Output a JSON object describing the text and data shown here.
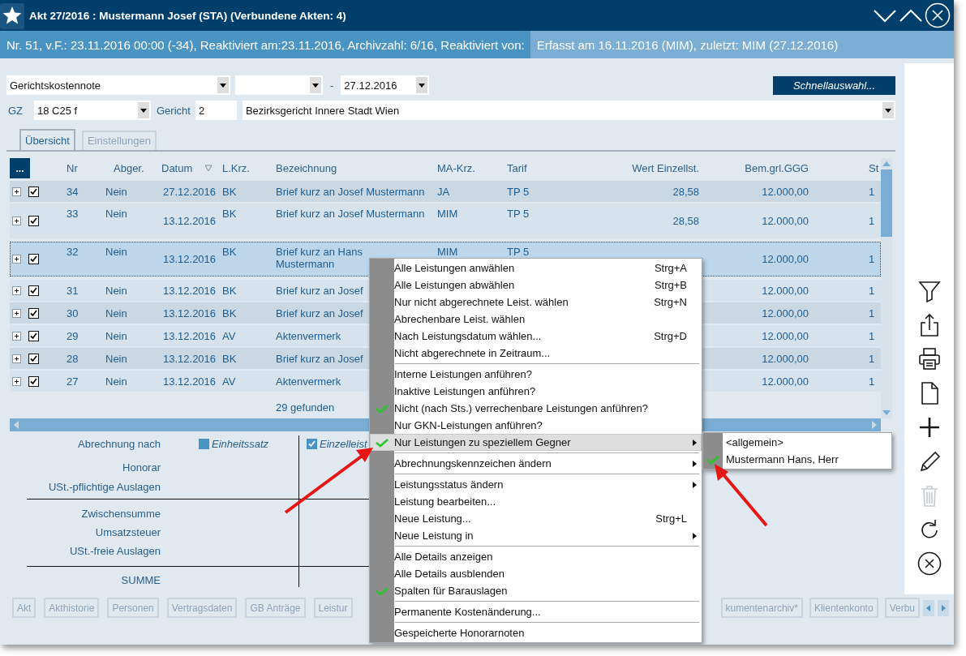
{
  "window": {
    "title": "Akt 27/2016 : Mustermann Josef (STA) (Verbundene Akten: 4)"
  },
  "info_bar": {
    "left": "Nr. 51, v.F.: 23.11.2016 00:00 (-34), Reaktiviert am:23.11.2016, Archivzahl: 6/16, Reaktiviert von:",
    "right": "Erfasst am 16.11.2016 (MIM), zuletzt: MIM (27.12.2016)"
  },
  "filter_row": {
    "document_type": "Gerichtskostennote",
    "date_separator": "-",
    "date_to": "27.12.2016",
    "quick_button": "Schnellauswahl..."
  },
  "court_row": {
    "gz_label": "GZ",
    "gz_value": "18 C25 f",
    "court_label": "Gericht",
    "court_number": "2",
    "court_name": "Bezirksgericht Innere Stadt Wien"
  },
  "tabs": [
    {
      "label": "Übersicht",
      "selected": true
    },
    {
      "label": "Einstellungen",
      "selected": false
    }
  ],
  "table": {
    "menu_button": "...",
    "columns": [
      {
        "label": "Nr",
        "sorted": false
      },
      {
        "label": "Abger.",
        "sorted": false
      },
      {
        "label": "Datum",
        "sorted": true
      },
      {
        "label": "L.Krz.",
        "sorted": false
      },
      {
        "label": "Bezeichnung",
        "sorted": false
      },
      {
        "label": "MA-Krz.",
        "sorted": false
      },
      {
        "label": "Tarif",
        "sorted": false
      },
      {
        "label": "Wert Einzellst.",
        "sorted": false
      },
      {
        "label": "Bem.grl.GGG",
        "sorted": false
      },
      {
        "label": "St",
        "sorted": false
      }
    ],
    "rows": [
      {
        "kind": "short",
        "expanded": false,
        "checked": true,
        "selected": false,
        "nr": "34",
        "abger": "Nein",
        "datum": "27.12.2016",
        "lkrz": "BK",
        "bezeichnung": "Brief kurz an Josef Mustermann",
        "ma_krz": "JA",
        "tarif": "TP 5",
        "wert": "28,58",
        "bem": "12.000,00",
        "st": "1"
      },
      {
        "kind": "tall",
        "expanded": false,
        "checked": true,
        "selected": false,
        "nr": "33",
        "abger": "Nein",
        "datum": "13.12.2016",
        "lkrz": "BK",
        "bezeichnung": "Brief kurz an Josef Mustermann",
        "ma_krz": "MIM",
        "tarif": "TP 5",
        "wert": "28,58",
        "bem": "12.000,00",
        "st": "1"
      },
      {
        "kind": "tall",
        "expanded": false,
        "checked": true,
        "selected": true,
        "nr": "32",
        "abger": "Nein",
        "datum": "13.12.2016",
        "lkrz": "BK",
        "bezeichnung": "Brief kurz an Hans\nMustermann",
        "ma_krz": "MIM",
        "tarif": "TP 5",
        "bem": "12.000,00",
        "st": "1"
      },
      {
        "kind": "short",
        "expanded": false,
        "checked": true,
        "selected": false,
        "nr": "31",
        "abger": "Nein",
        "datum": "13.12.2016",
        "lkrz": "BK",
        "bezeichnung": "Brief kurz an Josef",
        "bem": "12.000,00",
        "st": "1"
      },
      {
        "kind": "short",
        "expanded": false,
        "checked": true,
        "selected": false,
        "nr": "30",
        "abger": "Nein",
        "datum": "13.12.2016",
        "lkrz": "BK",
        "bezeichnung": "Brief kurz an Josef",
        "bem": "12.000,00",
        "st": "1"
      },
      {
        "kind": "short",
        "expanded": false,
        "checked": true,
        "selected": false,
        "nr": "29",
        "abger": "Nein",
        "datum": "13.12.2016",
        "lkrz": "AV",
        "bezeichnung": "Aktenvermerk",
        "bem": "12.000,00",
        "st": "1"
      },
      {
        "kind": "short",
        "expanded": false,
        "checked": true,
        "selected": false,
        "nr": "28",
        "abger": "Nein",
        "datum": "13.12.2016",
        "lkrz": "BK",
        "bezeichnung": "Brief kurz an Josef",
        "bem": "12.000,00",
        "st": "1"
      },
      {
        "kind": "short",
        "expanded": false,
        "checked": true,
        "selected": false,
        "nr": "27",
        "abger": "Nein",
        "datum": "13.12.2016",
        "lkrz": "AV",
        "bezeichnung": "Aktenvermerk",
        "bem": "12.000,00",
        "st": "1"
      }
    ],
    "footer": "29 gefunden"
  },
  "summary": {
    "basis_label": "Abrechnung nach",
    "options": [
      {
        "label": "Einheitssatz",
        "checked": false
      },
      {
        "label": "Einzelleist",
        "checked": true
      }
    ],
    "groups": [
      [
        "Honorar",
        "USt.-pflichtige Auslagen"
      ],
      [
        "Zwischensumme",
        "Umsatzsteuer",
        "USt.-freie Auslagen"
      ],
      [
        "SUMME"
      ]
    ]
  },
  "bottom_tabs": {
    "left": [
      "Akt",
      "Akthistorie",
      "Personen",
      "Vertragsdaten",
      "GB Anträge",
      "Leistur"
    ],
    "right": [
      "kumentenarchiv*",
      "Klientenkonto",
      "Verbu"
    ]
  },
  "sidebar_tools": [
    {
      "kind": "filter",
      "disabled": false
    },
    {
      "kind": "export",
      "disabled": false
    },
    {
      "kind": "print",
      "disabled": false
    },
    {
      "kind": "document",
      "disabled": false
    },
    {
      "kind": "add",
      "disabled": false
    },
    {
      "kind": "edit",
      "disabled": false
    },
    {
      "kind": "delete",
      "disabled": true
    },
    {
      "kind": "refresh",
      "disabled": false
    },
    {
      "kind": "cancel",
      "disabled": false
    }
  ],
  "context_menu": {
    "items": [
      {
        "kind": "item",
        "label": "Alle Leistungen anwählen",
        "shortcut": "Strg+A",
        "checked": false,
        "submenu": false,
        "selected": false
      },
      {
        "kind": "item",
        "label": "Alle Leistungen abwählen",
        "shortcut": "Strg+B",
        "checked": false,
        "submenu": false,
        "selected": false
      },
      {
        "kind": "item",
        "label": "Nur nicht abgerechnete Leist. wählen",
        "shortcut": "Strg+N",
        "checked": false,
        "submenu": false,
        "selected": false
      },
      {
        "kind": "item",
        "label": "Abrechenbare Leist. wählen",
        "checked": false,
        "submenu": false,
        "selected": false
      },
      {
        "kind": "item",
        "label": "Nach Leistungsdatum wählen...",
        "shortcut": "Strg+D",
        "checked": false,
        "submenu": false,
        "selected": false
      },
      {
        "kind": "item",
        "label": "Nicht abgerechnete in Zeitraum...",
        "checked": false,
        "submenu": false,
        "selected": false
      },
      {
        "kind": "separator"
      },
      {
        "kind": "item",
        "label": "Interne Leistungen anführen?",
        "checked": false,
        "submenu": false,
        "selected": false
      },
      {
        "kind": "item",
        "label": "Inaktive Leistungen anführen?",
        "checked": false,
        "submenu": false,
        "selected": false
      },
      {
        "kind": "item",
        "label": "Nicht (nach Sts.) verrechenbare Leistungen anführen?",
        "checked": true,
        "submenu": false,
        "selected": false
      },
      {
        "kind": "item",
        "label": "Nur GKN-Leistungen anführen?",
        "checked": false,
        "submenu": false,
        "selected": false
      },
      {
        "kind": "item",
        "label": "Nur Leistungen zu speziellem Gegner",
        "checked": true,
        "submenu": true,
        "selected": true
      },
      {
        "kind": "separator"
      },
      {
        "kind": "item",
        "label": "Abrechnungskennzeichen ändern",
        "checked": false,
        "submenu": true,
        "selected": false
      },
      {
        "kind": "separator"
      },
      {
        "kind": "item",
        "label": "Leistungsstatus ändern",
        "checked": false,
        "submenu": true,
        "selected": false
      },
      {
        "kind": "item",
        "label": "Leistung bearbeiten...",
        "checked": false,
        "submenu": false,
        "selected": false
      },
      {
        "kind": "item",
        "label": "Neue Leistung...",
        "shortcut": "Strg+L",
        "checked": false,
        "submenu": false,
        "selected": false
      },
      {
        "kind": "item",
        "label": "Neue Leistung in",
        "checked": false,
        "submenu": true,
        "selected": false
      },
      {
        "kind": "separator"
      },
      {
        "kind": "item",
        "label": "Alle Details anzeigen",
        "checked": false,
        "submenu": false,
        "selected": false
      },
      {
        "kind": "item",
        "label": "Alle Details ausblenden",
        "checked": false,
        "submenu": false,
        "selected": false
      },
      {
        "kind": "item",
        "label": "Spalten für Barauslagen",
        "checked": true,
        "submenu": false,
        "selected": false
      },
      {
        "kind": "separator"
      },
      {
        "kind": "item",
        "label": "Permanente Kostenänderung...",
        "checked": false,
        "submenu": false,
        "selected": false
      },
      {
        "kind": "separator"
      },
      {
        "kind": "item",
        "label": "Gespeicherte Honorarnoten",
        "checked": false,
        "submenu": false,
        "selected": false
      }
    ]
  },
  "submenu": {
    "items": [
      {
        "label": "<allgemein>",
        "checked": false
      },
      {
        "label": "Mustermann Hans, Herr",
        "checked": true
      }
    ]
  }
}
